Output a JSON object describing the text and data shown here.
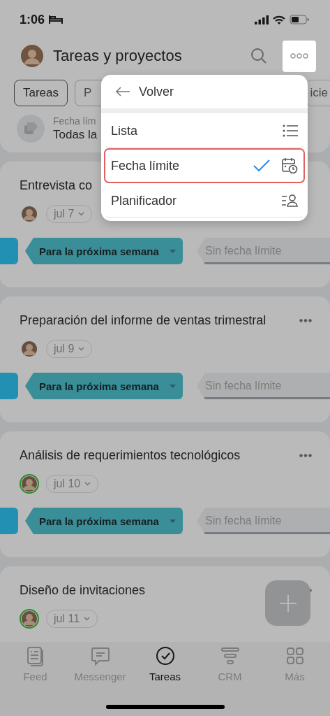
{
  "status_bar": {
    "time": "1:06"
  },
  "header": {
    "title": "Tareas y proyectos"
  },
  "filters": [
    {
      "label": "Tareas",
      "selected": true
    },
    {
      "label": "P",
      "selected": false
    },
    {
      "label": "icie",
      "selected": false
    }
  ],
  "summary": {
    "label": "Fecha lím",
    "value": "Todas la"
  },
  "tasks": [
    {
      "title": "Entrevista co",
      "date": "jul 7",
      "online": false,
      "show_menu": false,
      "stage": "Para la próxima semana",
      "next_stage": "Sin fecha límite"
    },
    {
      "title": "Preparación del informe de ventas trimestral",
      "date": "jul 9",
      "online": false,
      "show_menu": true,
      "stage": "Para la próxima semana",
      "next_stage": "Sin fecha límite"
    },
    {
      "title": "Análisis de requerimientos tecnológicos",
      "date": "jul 10",
      "online": true,
      "show_menu": true,
      "stage": "Para la próxima semana",
      "next_stage": "Sin fecha límite"
    },
    {
      "title": "Diseño de invitaciones",
      "date": "jul 11",
      "online": true,
      "show_menu": true
    }
  ],
  "menu": {
    "back": "Volver",
    "items": [
      {
        "label": "Lista",
        "kind": "list",
        "selected": false
      },
      {
        "label": "Fecha límite",
        "kind": "deadline",
        "selected": true
      },
      {
        "label": "Planificador",
        "kind": "planner",
        "selected": false
      }
    ]
  },
  "tabbar": [
    {
      "label": "Feed",
      "kind": "feed",
      "selected": false
    },
    {
      "label": "Messenger",
      "kind": "messenger",
      "selected": false
    },
    {
      "label": "Tareas",
      "kind": "tasks",
      "selected": true
    },
    {
      "label": "CRM",
      "kind": "crm",
      "selected": false
    },
    {
      "label": "Más",
      "kind": "more",
      "selected": false
    }
  ]
}
